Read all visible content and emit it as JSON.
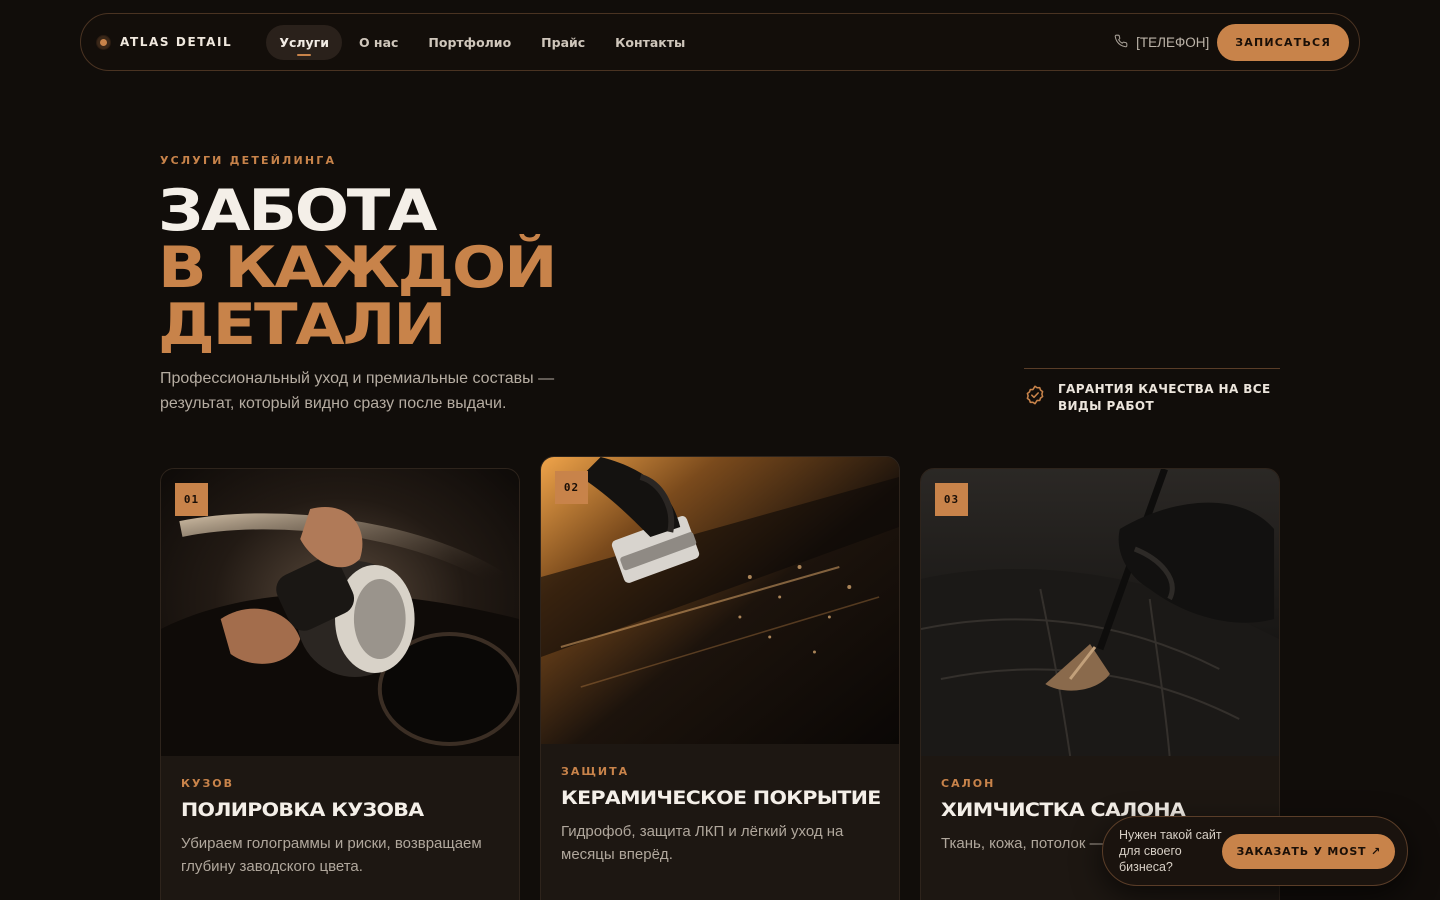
{
  "header": {
    "brand": "ATLAS DETAIL",
    "nav": [
      "Услуги",
      "О нас",
      "Портфолио",
      "Прайс",
      "Контакты"
    ],
    "active_nav": "Услуги",
    "phone": "[ТЕЛЕФОН]",
    "cta": "ЗАПИСАТЬСЯ"
  },
  "hero": {
    "eyebrow": "УСЛУГИ ДЕТЕЙЛИНГА",
    "title_line1": "ЗАБОТА",
    "title_line2": "В КАЖДОЙ",
    "title_line3": "ДЕТАЛИ",
    "subtitle": "Профессиональный уход и премиальные составы — результат, который видно сразу после выдачи.",
    "guarantee": "ГАРАНТИЯ КАЧЕСТВА НА ВСЕ ВИДЫ РАБОТ"
  },
  "cards": [
    {
      "num": "01",
      "category": "КУЗОВ",
      "title": "ПОЛИРОВКА КУЗОВА",
      "text": "Убираем голограммы и риски, возвращаем глубину заводского цвета."
    },
    {
      "num": "02",
      "category": "ЗАЩИТА",
      "title": "КЕРАМИЧЕСКОЕ ПОКРЫТИЕ",
      "text": "Гидрофоб, защита ЛКП и лёгкий уход на месяцы вперёд."
    },
    {
      "num": "03",
      "category": "САЛОН",
      "title": "ХИМЧИСТКА САЛОНА",
      "text": "Ткань, кожа, потолок — и разводов."
    }
  ],
  "promo": {
    "text": "Нужен такой сайт для своего бизнеса?",
    "button": "ЗАКАЗАТЬ У MOST ↗"
  },
  "colors": {
    "background": "#110d0a",
    "accent": "#c8834a",
    "card": "#1d1712"
  },
  "icons": {
    "phone": "phone-icon",
    "guarantee": "check-badge-icon",
    "brand": "brand-dot-icon"
  }
}
